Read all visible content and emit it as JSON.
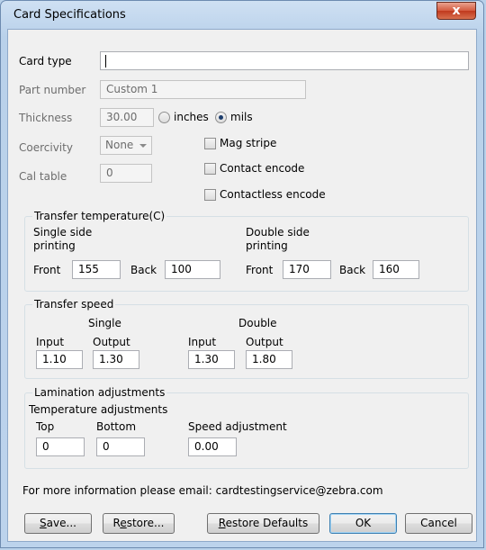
{
  "window": {
    "title": "Card Specifications",
    "close_label": "x"
  },
  "card_type": {
    "label": "Card type",
    "value": ""
  },
  "part_number": {
    "label": "Part number",
    "value": "Custom 1"
  },
  "thickness": {
    "label": "Thickness",
    "value": "30.00",
    "unit_inches": "inches",
    "unit_mils": "mils",
    "selected_unit": "mils"
  },
  "coercivity": {
    "label": "Coercivity",
    "value": "None"
  },
  "cal_table": {
    "label": "Cal table",
    "value": "0"
  },
  "options": {
    "mag_stripe": {
      "label": "Mag stripe",
      "checked": false
    },
    "contact_encode": {
      "label": "Contact encode",
      "checked": false
    },
    "contactless_encode": {
      "label": "Contactless encode",
      "checked": false
    }
  },
  "transfer_temperature": {
    "title": "Transfer temperature(C)",
    "single_heading_1": "Single side",
    "single_heading_2": "printing",
    "double_heading_1": "Double side",
    "double_heading_2": "printing",
    "front_label": "Front",
    "back_label": "Back",
    "single_front": "155",
    "single_back": "100",
    "double_front": "170",
    "double_back": "160"
  },
  "transfer_speed": {
    "title": "Transfer speed",
    "single_heading": "Single",
    "double_heading": "Double",
    "input_label": "Input",
    "output_label": "Output",
    "single_input": "1.10",
    "single_output": "1.30",
    "double_input": "1.30",
    "double_output": "1.80"
  },
  "lamination": {
    "title": "Lamination adjustments",
    "temp_heading": "Temperature adjustments",
    "top_label": "Top",
    "bottom_label": "Bottom",
    "speed_label": "Speed adjustment",
    "top_value": "0",
    "bottom_value": "0",
    "speed_value": "0.00"
  },
  "info_text": "For more information  please email: cardtestingservice@zebra.com",
  "buttons": {
    "save_mnemonic": "S",
    "save_rest": "ave...",
    "restore_prefix": "R",
    "restore_mnemonic": "e",
    "restore_rest": "store...",
    "restore_defaults_mnemonic": "R",
    "restore_defaults_rest": "estore Defaults",
    "ok": "OK",
    "cancel": "Cancel"
  }
}
